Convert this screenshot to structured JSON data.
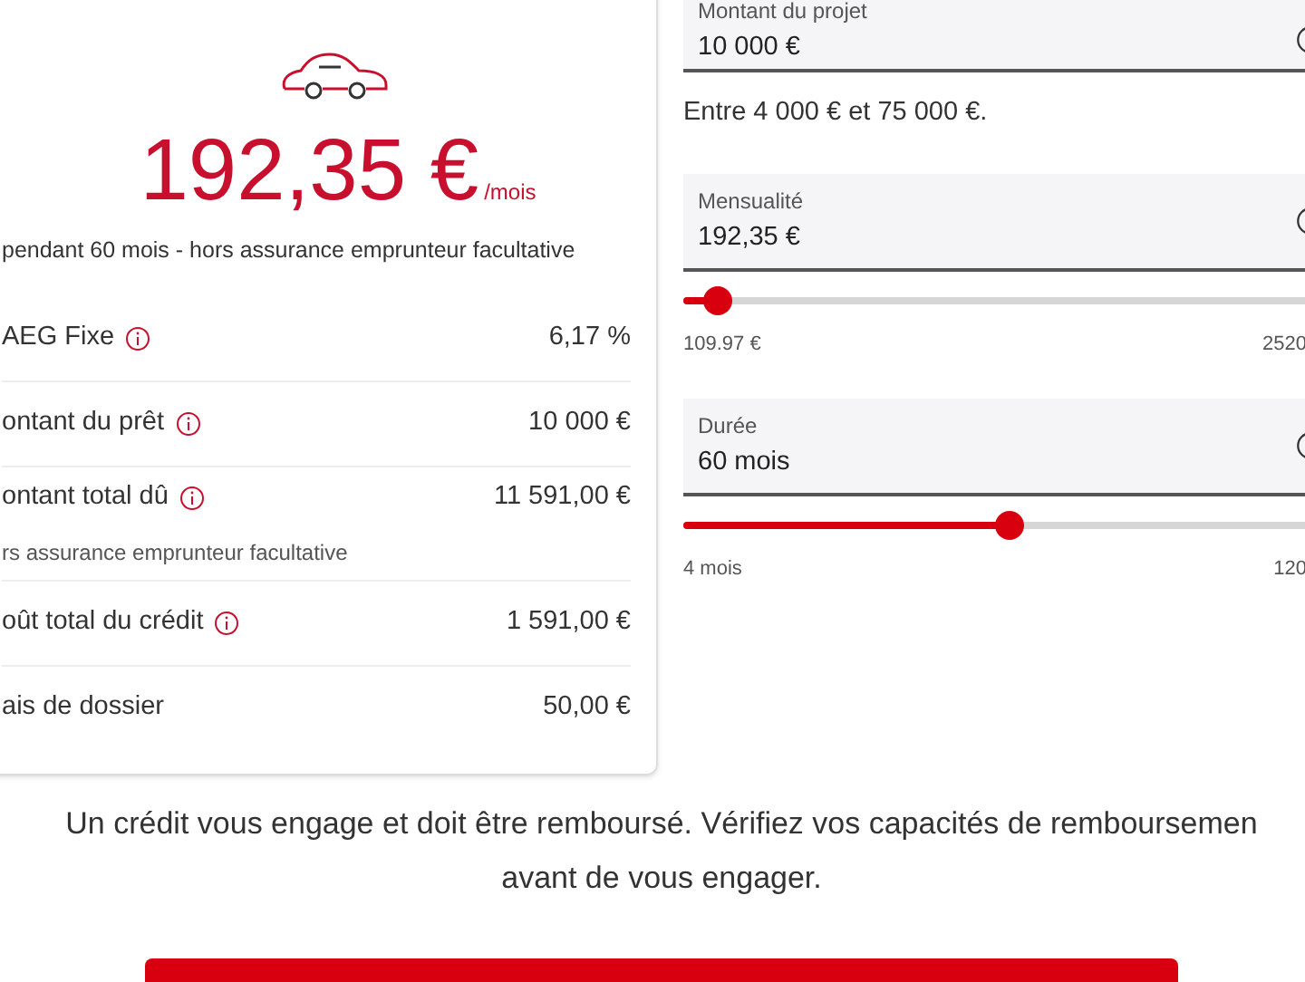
{
  "result": {
    "amount": "192,35 €",
    "unit": "/mois",
    "subtitle": "pendant 60 mois - hors assurance emprunteur facultative"
  },
  "details": [
    {
      "label": "AEG Fixe",
      "info": true,
      "value": "6,17 %"
    },
    {
      "label": "ontant du prêt",
      "info": true,
      "value": "10 000 €"
    },
    {
      "label": "ontant total dû",
      "info": true,
      "value": "11 591,00 €",
      "note": "rs assurance emprunteur facultative"
    },
    {
      "label": "oût total du crédit",
      "info": true,
      "value": "1 591,00 €"
    },
    {
      "label": "ais de dossier",
      "info": false,
      "value": "50,00 €"
    }
  ],
  "fields": [
    {
      "label": "Montant du projet",
      "value": "10 000 €",
      "helper": "Entre 4 000 € et 75 000 €."
    },
    {
      "label": "Mensualité",
      "value": "192,35 €",
      "slider": {
        "level": 0.05,
        "min": "109.97 €",
        "max": "2520"
      }
    },
    {
      "label": "Durée",
      "value": "60 mois",
      "slider": {
        "level": 0.47,
        "min": "4 mois",
        "max": "120"
      }
    }
  ],
  "disclaimer": [
    "Un crédit vous engage et doit être remboursé. Vérifiez vos capacités de remboursemen",
    "avant de vous engager."
  ]
}
